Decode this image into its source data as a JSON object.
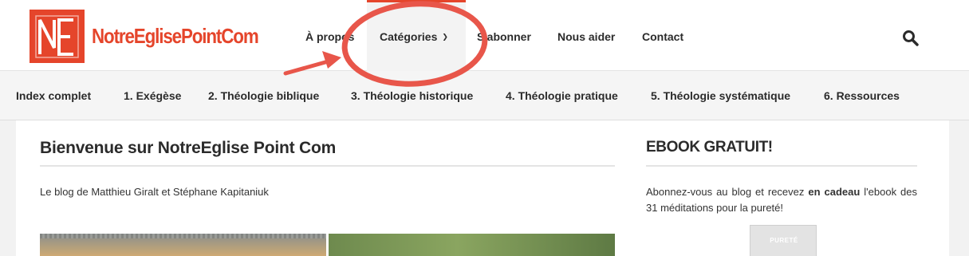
{
  "brand": {
    "logo_letters": "NE",
    "name": "NotreEglisePointCom",
    "color": "#e5452b"
  },
  "nav": {
    "items": [
      {
        "label": "À propos"
      },
      {
        "label": "Catégories",
        "icon": "chevron-down-icon"
      },
      {
        "label": "S'abonner"
      },
      {
        "label": "Nous aider"
      },
      {
        "label": "Contact"
      }
    ],
    "search_icon": "search-icon"
  },
  "categories": [
    {
      "label": "Index complet"
    },
    {
      "label": "1. Exégèse"
    },
    {
      "label": "2. Théologie biblique"
    },
    {
      "label": "3. Théologie historique"
    },
    {
      "label": "4. Théologie pratique"
    },
    {
      "label": "5. Théologie systématique"
    },
    {
      "label": "6. Ressources"
    }
  ],
  "main": {
    "title": "Bienvenue sur NotreEglise Point Com",
    "intro": "Le blog de Matthieu Giralt et Stéphane Kapitaniuk"
  },
  "sidebar": {
    "title": "EBOOK GRATUIT!",
    "text_before": "Abonnez-vous au blog et recevez ",
    "text_bold": "en cadeau",
    "text_after": " l'ebook des 31 méditations pour la pureté!",
    "book_title": "PURETÉ"
  },
  "annotation": {
    "type": "red-circle-arrow",
    "color": "#e8564a",
    "target": "Catégories"
  }
}
